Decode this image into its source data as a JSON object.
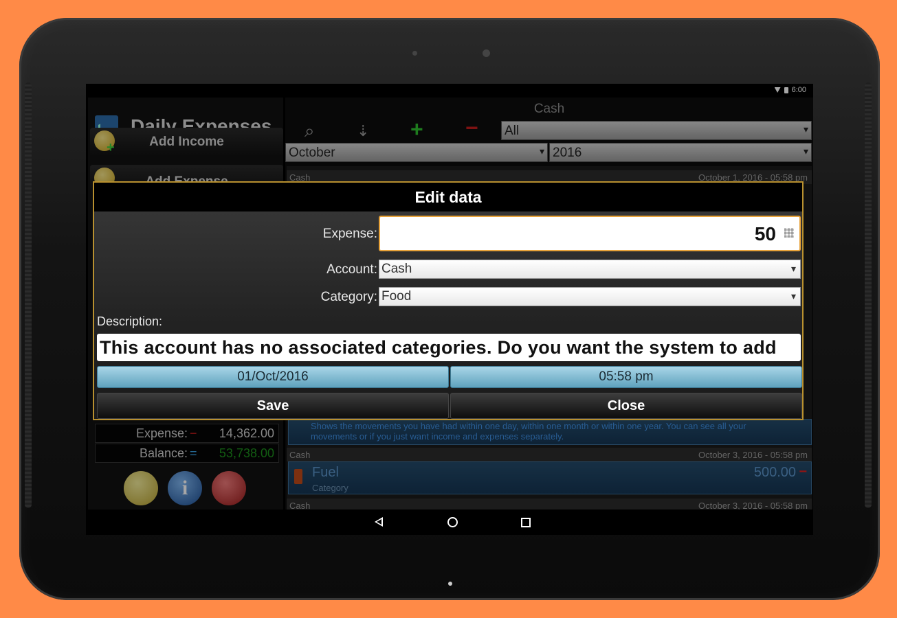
{
  "status": {
    "time": "6:00"
  },
  "app": {
    "title": "Daily Expenses"
  },
  "menu": {
    "add_income": "Add Income",
    "add_expense": "Add Expense"
  },
  "summary": {
    "expense_label": "Expense:",
    "expense_mark": "−",
    "expense_value": "14,362.00",
    "balance_label": "Balance:",
    "balance_mark": "=",
    "balance_value": "53,738.00"
  },
  "header": {
    "account": "Cash",
    "filter": "All",
    "month": "October",
    "year": "2016"
  },
  "list": {
    "row1": {
      "account": "Cash",
      "date": "October 1, 2016 - 05:58 pm"
    },
    "tip": "Shows the movements you have had within one day, within one month or within one year. You can see all your movements or if you just want income and expenses separately.",
    "row3": {
      "account": "Cash",
      "date": "October 3, 2016 - 05:58 pm",
      "name": "Fuel",
      "amount": "500.00",
      "sign": "−",
      "sub": "Category"
    },
    "row4": {
      "account": "Cash",
      "date": "October 3, 2016 - 05:58 pm"
    }
  },
  "dialog": {
    "title": "Edit data",
    "expense_label": "Expense:",
    "expense_value": "50",
    "account_label": "Account:",
    "account_value": "Cash",
    "category_label": "Category:",
    "category_value": "Food",
    "description_label": "Description:",
    "description_value": "This account has no associated categories.  Do you want the system to add",
    "date": "01/Oct/2016",
    "time": "05:58 pm",
    "save": "Save",
    "close": "Close"
  },
  "colors": {
    "accent": "#b8902f",
    "background": "#ff8a47",
    "balance": "#1c8f1c",
    "expense_mark": "#e02020"
  }
}
